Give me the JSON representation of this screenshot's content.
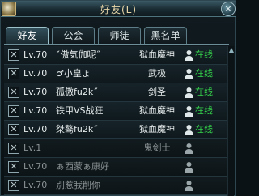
{
  "window": {
    "title": "好友(L)",
    "close_label": "×"
  },
  "tabs": [
    {
      "label": "好友",
      "active": true
    },
    {
      "label": "公会",
      "active": false
    },
    {
      "label": "师徒",
      "active": false
    },
    {
      "label": "黑名单",
      "active": false
    }
  ],
  "friends": [
    {
      "checkbox": "✕",
      "level": "Lv.70",
      "name": "ˇ傲気伽呢˝",
      "class": "狱血魔神",
      "status": "在线",
      "online": true
    },
    {
      "checkbox": "✕",
      "level": "Lv.70",
      "name": "♂小皇ょ",
      "class": "武极",
      "status": "在线",
      "online": true
    },
    {
      "checkbox": "✕",
      "level": "Lv.70",
      "name": "孤傲fu2k˝",
      "class": "剑圣",
      "status": "在线",
      "online": true
    },
    {
      "checkbox": "✕",
      "level": "Lv.70",
      "name": "铁甲VS战狂",
      "class": "狱血魔神",
      "status": "在线",
      "online": true
    },
    {
      "checkbox": "✕",
      "level": "Lv.70",
      "name": "桀骜fu2k˝",
      "class": "狱血魔神",
      "status": "在线",
      "online": true
    },
    {
      "checkbox": "✕",
      "level": "Lv.1",
      "name": "",
      "class": "鬼剑士",
      "status": "",
      "online": false
    },
    {
      "checkbox": "✕",
      "level": "Lv.70",
      "name": "ぁ西蒙ぁ康好",
      "class": "",
      "status": "",
      "online": false
    },
    {
      "checkbox": "✕",
      "level": "Lv.70",
      "name": "别惹我削你",
      "class": "",
      "status": "",
      "online": false
    }
  ],
  "colors": {
    "online_status": "#35d24b",
    "title_text": "#e8d6a8"
  },
  "icons": {
    "status": "person-icon",
    "window": "profile-icon"
  }
}
